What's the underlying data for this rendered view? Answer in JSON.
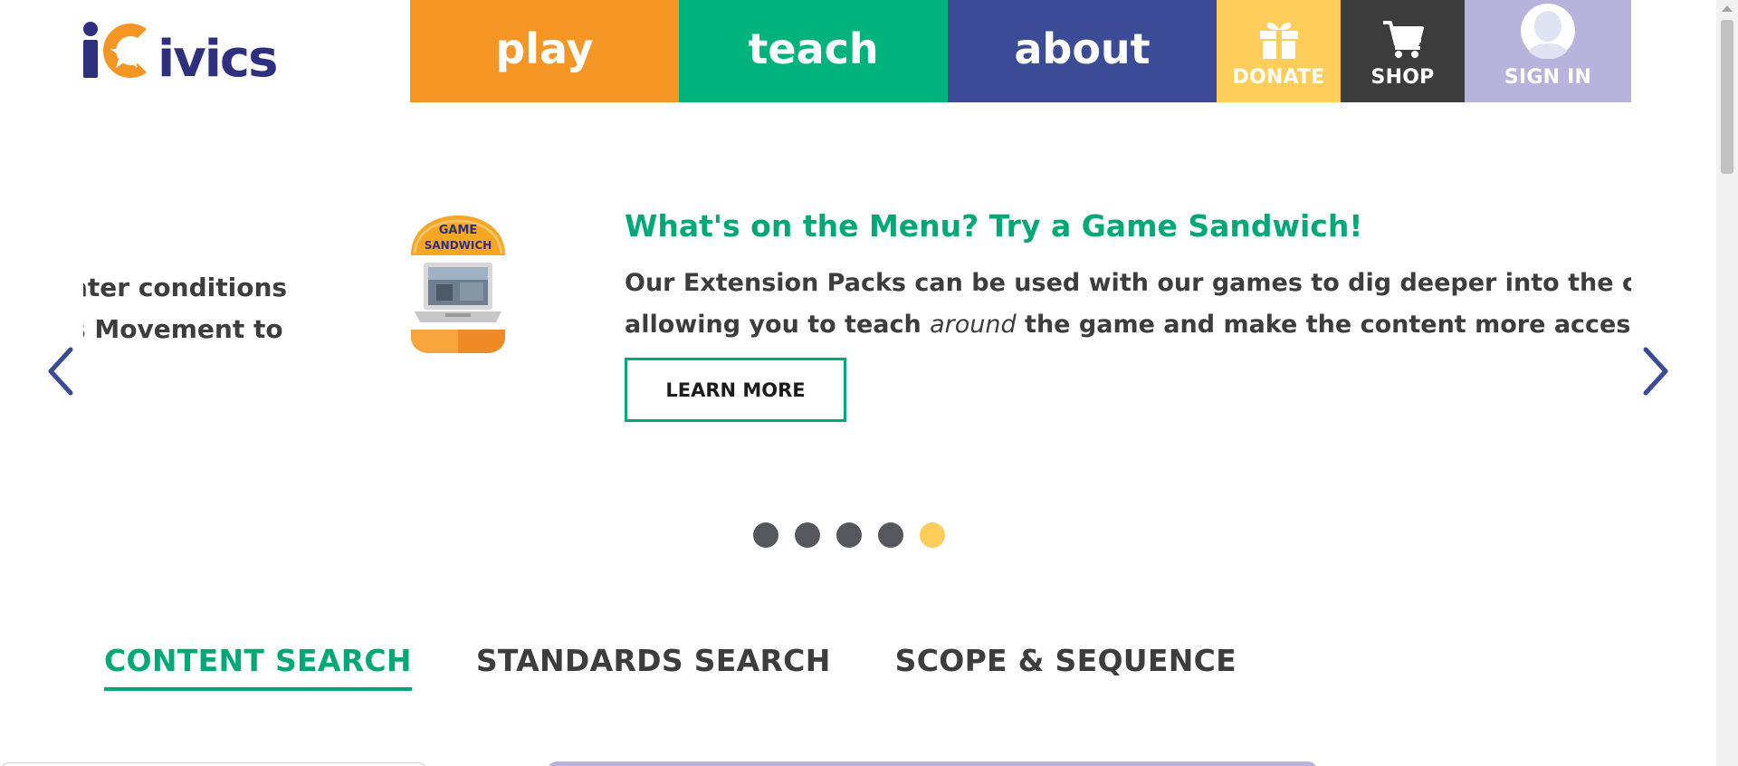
{
  "header": {
    "logo_text": "iCivics",
    "nav": {
      "play": "play",
      "teach": "teach",
      "about": "about",
      "donate": "DONATE",
      "shop": "SHOP",
      "sign_in": "SIGN IN"
    }
  },
  "carousel": {
    "previous_slide_lines": [
      "ater conditions",
      "s Movement to"
    ],
    "slide": {
      "image_text": [
        "GAME",
        "SANDWICH"
      ],
      "title": "What's on the Menu? Try a Game Sandwich!",
      "body_line1": "Our Extension Packs can be used with our games to dig deeper into the concepts presented,",
      "body_line2_before": "allowing you to teach ",
      "body_line2_emphasis": "around",
      "body_line2_after": " the game and make the content more accessible to all students.",
      "button_label": "LEARN MORE"
    },
    "dots_count": 5,
    "active_dot": 5
  },
  "tabs": [
    {
      "label": "CONTENT SEARCH",
      "active": true
    },
    {
      "label": "STANDARDS SEARCH",
      "active": false
    },
    {
      "label": "SCOPE & SEQUENCE",
      "active": false
    }
  ],
  "colors": {
    "play": "#f59523",
    "teach": "#00b27c",
    "about": "#3b4b96",
    "donate": "#ffcd59",
    "shop": "#3c3c3c",
    "sign_in": "#b8b3dc",
    "accent_green": "#00a877",
    "logo_navy": "#2e2f7f",
    "logo_orange": "#f59523"
  },
  "icons": [
    "gift-icon",
    "cart-icon",
    "avatar-icon",
    "chevron-left-icon",
    "chevron-right-icon"
  ]
}
